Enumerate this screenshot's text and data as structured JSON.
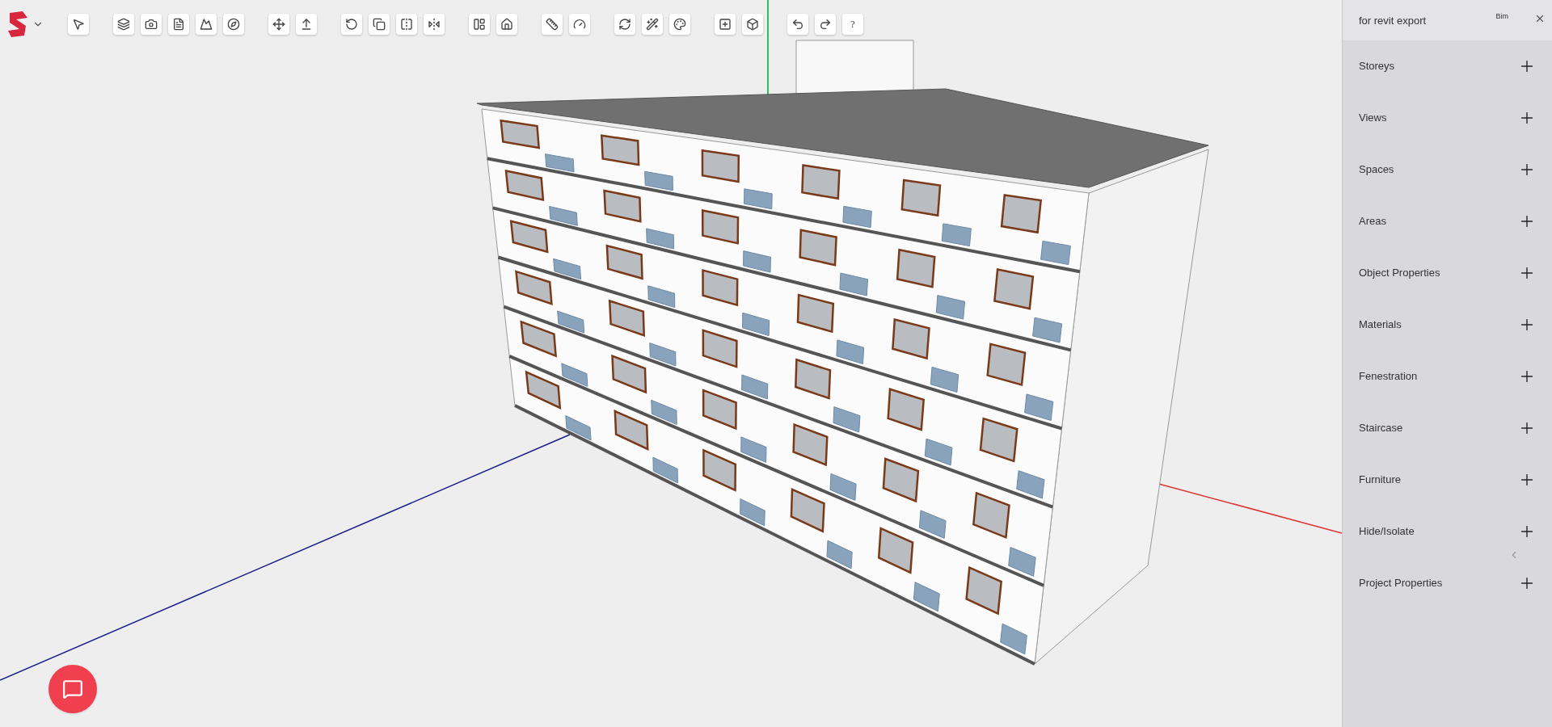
{
  "toolbar": {
    "help_label": "?"
  },
  "panel": {
    "title": "for revit export",
    "badge": "Bim",
    "sections": [
      {
        "label": "Storeys",
        "expanded": false
      },
      {
        "label": "Views",
        "expanded": false
      },
      {
        "label": "Spaces",
        "expanded": false
      },
      {
        "label": "Areas",
        "expanded": false
      },
      {
        "label": "Object Properties",
        "expanded": false
      },
      {
        "label": "Materials",
        "expanded": false
      },
      {
        "label": "Fenestration",
        "expanded": false
      },
      {
        "label": "Staircase",
        "expanded": false
      },
      {
        "label": "Furniture",
        "expanded": false
      },
      {
        "label": "Hide/Isolate",
        "expanded": false
      },
      {
        "label": "Project Properties",
        "expanded": false
      }
    ]
  }
}
